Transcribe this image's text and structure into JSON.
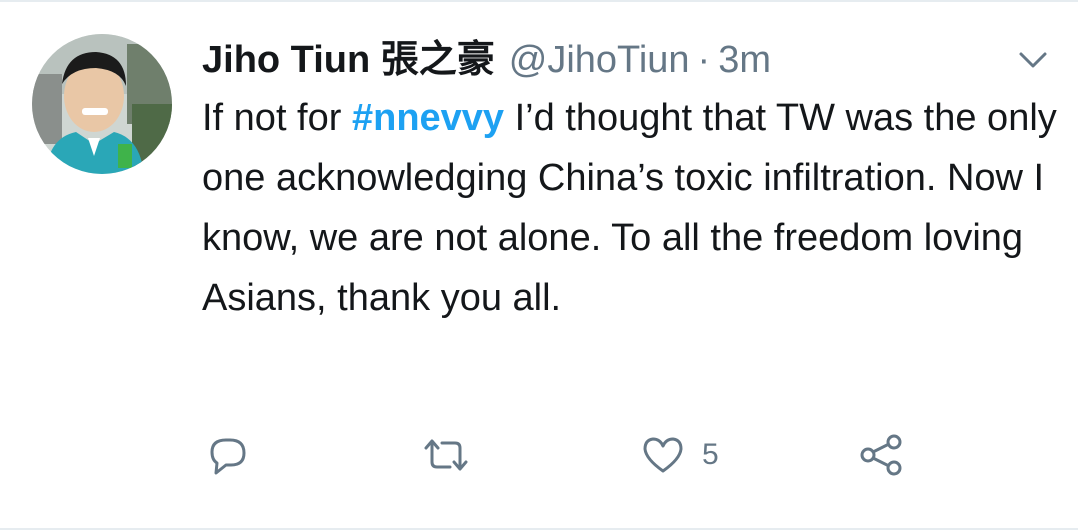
{
  "tweet": {
    "display_name": "Jiho Tiun 張之豪",
    "handle": "@JihoTiun",
    "separator": "·",
    "time": "3m",
    "text_before": "If not for ",
    "hashtag": "#nnevvy",
    "text_after": " I’d thought that TW was the only one acknowledging China’s toxic infiltration.  Now I know, we are not alone.  To all the freedom loving Asians, thank you all.",
    "avatar_icon": "user-photo",
    "caret_icon": "chevron-down-icon"
  },
  "actions": {
    "reply_icon": "reply-icon",
    "retweet_icon": "retweet-icon",
    "like_icon": "heart-icon",
    "like_count": "5",
    "share_icon": "share-icon"
  },
  "colors": {
    "accent": "#1da1f2",
    "secondary_text": "#657786",
    "primary_text": "#14171a",
    "border": "#e6ecf0"
  }
}
